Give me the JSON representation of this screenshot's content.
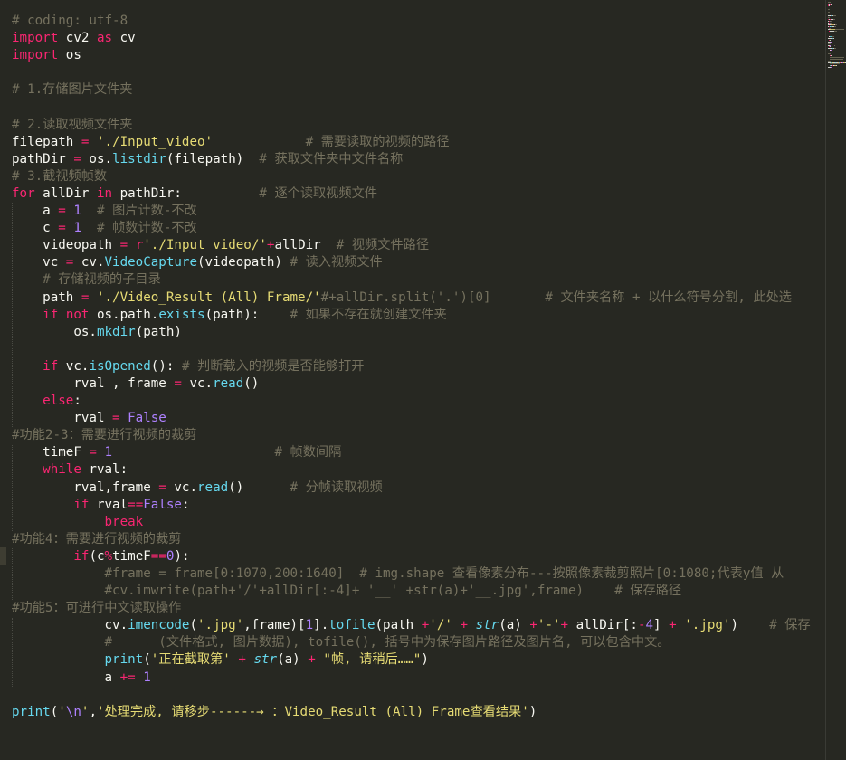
{
  "editor": {
    "language": "python",
    "theme_colors": {
      "background": "#272822",
      "comment": "#75715E",
      "keyword": "#F92672",
      "string": "#E6DB74",
      "number": "#AE81FF",
      "function": "#66D9EF",
      "text": "#F8F8F2"
    },
    "lines": [
      [
        [
          "c",
          "# coding: utf-8"
        ]
      ],
      [
        [
          "k",
          "import"
        ],
        [
          "p",
          " cv2 "
        ],
        [
          "k",
          "as"
        ],
        [
          "p",
          " cv"
        ]
      ],
      [
        [
          "k",
          "import"
        ],
        [
          "p",
          " os"
        ]
      ],
      [],
      [
        [
          "c",
          "# 1.存储图片文件夹"
        ]
      ],
      [],
      [
        [
          "c",
          "# 2.读取视频文件夹"
        ]
      ],
      [
        [
          "p",
          "filepath "
        ],
        [
          "o",
          "="
        ],
        [
          "p",
          " "
        ],
        [
          "s",
          "'./Input_video'"
        ],
        [
          "p",
          "            "
        ],
        [
          "c",
          "# 需要读取的视频的路径"
        ]
      ],
      [
        [
          "p",
          "pathDir "
        ],
        [
          "o",
          "="
        ],
        [
          "p",
          " os."
        ],
        [
          "f",
          "listdir"
        ],
        [
          "p",
          "(filepath)  "
        ],
        [
          "c",
          "# 获取文件夹中文件名称"
        ]
      ],
      [
        [
          "c",
          "# 3.截视频帧数"
        ]
      ],
      [
        [
          "k",
          "for"
        ],
        [
          "p",
          " allDir "
        ],
        [
          "k",
          "in"
        ],
        [
          "p",
          " pathDir:          "
        ],
        [
          "c",
          "# 逐个读取视频文件"
        ]
      ],
      [
        [
          "p",
          "    a "
        ],
        [
          "o",
          "="
        ],
        [
          "p",
          " "
        ],
        [
          "n",
          "1"
        ],
        [
          "p",
          "  "
        ],
        [
          "c",
          "# 图片计数-不改"
        ]
      ],
      [
        [
          "p",
          "    c "
        ],
        [
          "o",
          "="
        ],
        [
          "p",
          " "
        ],
        [
          "n",
          "1"
        ],
        [
          "p",
          "  "
        ],
        [
          "c",
          "# 帧数计数-不改"
        ]
      ],
      [
        [
          "p",
          "    videopath "
        ],
        [
          "o",
          "="
        ],
        [
          "p",
          " "
        ],
        [
          "k",
          "r"
        ],
        [
          "s",
          "'./Input_video/'"
        ],
        [
          "o",
          "+"
        ],
        [
          "p",
          "allDir  "
        ],
        [
          "c",
          "# 视频文件路径"
        ]
      ],
      [
        [
          "p",
          "    vc "
        ],
        [
          "o",
          "="
        ],
        [
          "p",
          " cv."
        ],
        [
          "f",
          "VideoCapture"
        ],
        [
          "p",
          "(videopath) "
        ],
        [
          "c",
          "# 读入视频文件"
        ]
      ],
      [
        [
          "p",
          "    "
        ],
        [
          "c",
          "# 存储视频的子目录"
        ]
      ],
      [
        [
          "p",
          "    path "
        ],
        [
          "o",
          "="
        ],
        [
          "p",
          " "
        ],
        [
          "s",
          "'./Video_Result (All) Frame/'"
        ],
        [
          "c",
          "#+allDir.split('.')[0]       # 文件夹名称 + 以什么符号分割, 此处选"
        ]
      ],
      [
        [
          "p",
          "    "
        ],
        [
          "k",
          "if"
        ],
        [
          "p",
          " "
        ],
        [
          "k",
          "not"
        ],
        [
          "p",
          " os.path."
        ],
        [
          "f",
          "exists"
        ],
        [
          "p",
          "(path):    "
        ],
        [
          "c",
          "# 如果不存在就创建文件夹"
        ]
      ],
      [
        [
          "p",
          "        os."
        ],
        [
          "f",
          "mkdir"
        ],
        [
          "p",
          "(path)"
        ]
      ],
      [],
      [
        [
          "p",
          "    "
        ],
        [
          "k",
          "if"
        ],
        [
          "p",
          " vc."
        ],
        [
          "f",
          "isOpened"
        ],
        [
          "p",
          "(): "
        ],
        [
          "c",
          "# 判断载入的视频是否能够打开"
        ]
      ],
      [
        [
          "p",
          "        rval , frame "
        ],
        [
          "o",
          "="
        ],
        [
          "p",
          " vc."
        ],
        [
          "f",
          "read"
        ],
        [
          "p",
          "()"
        ]
      ],
      [
        [
          "p",
          "    "
        ],
        [
          "k",
          "else"
        ],
        [
          "p",
          ":"
        ]
      ],
      [
        [
          "p",
          "        rval "
        ],
        [
          "o",
          "="
        ],
        [
          "p",
          " "
        ],
        [
          "n",
          "False"
        ]
      ],
      [
        [
          "c",
          "#功能2-3：需要进行视频的裁剪"
        ]
      ],
      [
        [
          "p",
          "    timeF "
        ],
        [
          "o",
          "="
        ],
        [
          "p",
          " "
        ],
        [
          "n",
          "1"
        ],
        [
          "p",
          "                     "
        ],
        [
          "c",
          "# 帧数间隔"
        ]
      ],
      [
        [
          "p",
          "    "
        ],
        [
          "k",
          "while"
        ],
        [
          "p",
          " rval:"
        ]
      ],
      [
        [
          "p",
          "        rval,frame "
        ],
        [
          "o",
          "="
        ],
        [
          "p",
          " vc."
        ],
        [
          "f",
          "read"
        ],
        [
          "p",
          "()      "
        ],
        [
          "c",
          "# 分帧读取视频"
        ]
      ],
      [
        [
          "p",
          "        "
        ],
        [
          "k",
          "if"
        ],
        [
          "p",
          " rval"
        ],
        [
          "o",
          "=="
        ],
        [
          "n",
          "False"
        ],
        [
          "p",
          ":"
        ]
      ],
      [
        [
          "p",
          "            "
        ],
        [
          "k",
          "break"
        ]
      ],
      [
        [
          "c",
          "#功能4：需要进行视频的裁剪"
        ]
      ],
      [
        [
          "p",
          "        "
        ],
        [
          "k",
          "if"
        ],
        [
          "p",
          "(c"
        ],
        [
          "o",
          "%"
        ],
        [
          "p",
          "timeF"
        ],
        [
          "o",
          "=="
        ],
        [
          "n",
          "0"
        ],
        [
          "p",
          "):"
        ]
      ],
      [
        [
          "p",
          "            "
        ],
        [
          "c",
          "#frame = frame[0:1070,200:1640]  # img.shape 查看像素分布---按照像素裁剪照片[0:1080;代表y值 从"
        ]
      ],
      [
        [
          "p",
          "            "
        ],
        [
          "c",
          "#cv.imwrite(path+'/'+allDir[:-4]+ '__' +str(a)+'__.jpg',frame)    # 保存路径"
        ]
      ],
      [
        [
          "c",
          "#功能5：可进行中文读取操作"
        ]
      ],
      [
        [
          "p",
          "            cv."
        ],
        [
          "f",
          "imencode"
        ],
        [
          "p",
          "("
        ],
        [
          "s",
          "'.jpg'"
        ],
        [
          "p",
          ",frame)["
        ],
        [
          "n",
          "1"
        ],
        [
          "p",
          "]."
        ],
        [
          "f",
          "tofile"
        ],
        [
          "p",
          "(path "
        ],
        [
          "o",
          "+"
        ],
        [
          "s",
          "'/'"
        ],
        [
          "p",
          " "
        ],
        [
          "o",
          "+"
        ],
        [
          "p",
          " "
        ],
        [
          "i",
          "str"
        ],
        [
          "p",
          "(a) "
        ],
        [
          "o",
          "+"
        ],
        [
          "s",
          "'-'"
        ],
        [
          "o",
          "+"
        ],
        [
          "p",
          " allDir[:"
        ],
        [
          "o",
          "-"
        ],
        [
          "n",
          "4"
        ],
        [
          "p",
          "] "
        ],
        [
          "o",
          "+"
        ],
        [
          "p",
          " "
        ],
        [
          "s",
          "'.jpg'"
        ],
        [
          "p",
          ")    "
        ],
        [
          "c",
          "# 保存"
        ]
      ],
      [
        [
          "p",
          "            "
        ],
        [
          "c",
          "#      (文件格式, 图片数据), tofile(), 括号中为保存图片路径及图片名, 可以包含中文。"
        ]
      ],
      [
        [
          "p",
          "            "
        ],
        [
          "f",
          "print"
        ],
        [
          "p",
          "("
        ],
        [
          "s",
          "'正在截取第'"
        ],
        [
          "p",
          " "
        ],
        [
          "o",
          "+"
        ],
        [
          "p",
          " "
        ],
        [
          "i",
          "str"
        ],
        [
          "p",
          "(a) "
        ],
        [
          "o",
          "+"
        ],
        [
          "p",
          " "
        ],
        [
          "s",
          "\"帧, 请稍后……\""
        ],
        [
          "p",
          ")"
        ]
      ],
      [
        [
          "p",
          "            a "
        ],
        [
          "o",
          "+="
        ],
        [
          "p",
          " "
        ],
        [
          "n",
          "1"
        ]
      ],
      [],
      [
        [
          "f",
          "print"
        ],
        [
          "p",
          "("
        ],
        [
          "s",
          "'"
        ],
        [
          "n",
          "\\n"
        ],
        [
          "s",
          "'"
        ],
        [
          "p",
          ","
        ],
        [
          "s",
          "'处理完成, 请移步------→ ：Video_Result (All) Frame查看结果'"
        ],
        [
          "p",
          ")"
        ]
      ]
    ]
  }
}
